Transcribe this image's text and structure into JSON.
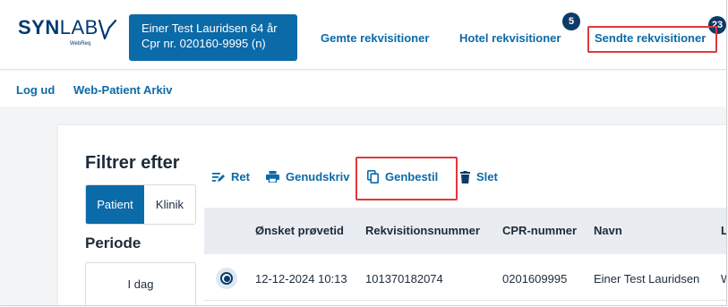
{
  "brand": {
    "logo_bold": "SYN",
    "logo_light": "LAB",
    "logo_sub": "WebReq",
    "color": "#003a70"
  },
  "patient": {
    "line1": "Einer Test Lauridsen 64 år",
    "line2": "Cpr nr. 020160-9995 (n)"
  },
  "nav": {
    "saved": "Gemte rekvisitioner",
    "hotel": "Hotel rekvisitioner",
    "hotel_badge": "5",
    "sent": "Sendte rekvisitioner",
    "sent_badge": "23"
  },
  "subnav": {
    "logout": "Log ud",
    "archive": "Web-Patient Arkiv"
  },
  "filter": {
    "title": "Filtrer efter",
    "tab_patient": "Patient",
    "tab_klinik": "Klinik",
    "selected": "Patient",
    "period_title": "Periode",
    "period_today": "I dag"
  },
  "toolbar": {
    "edit": "Ret",
    "reprint": "Genudskriv",
    "reorder": "Genbestil",
    "delete": "Slet",
    "edit_icon": "edit-lines-icon",
    "reprint_icon": "printer-icon",
    "reorder_icon": "copy-icon",
    "delete_icon": "trash-icon"
  },
  "table": {
    "columns": [
      "Ønsket prøvetid",
      "Rekvisitionsnummer",
      "CPR-nummer",
      "Navn",
      "L"
    ],
    "rows": [
      {
        "selected": true,
        "cells": [
          "12-12-2024 10:13",
          "101370182074",
          "0201609995",
          "Einer Test Lauridsen",
          "W"
        ]
      }
    ]
  },
  "colors": {
    "primary": "#0b6aa8",
    "badge": "#0b3b66",
    "highlight": "#e0383c",
    "text": "#1d2b3a",
    "table_header_bg": "#e9edf1"
  }
}
